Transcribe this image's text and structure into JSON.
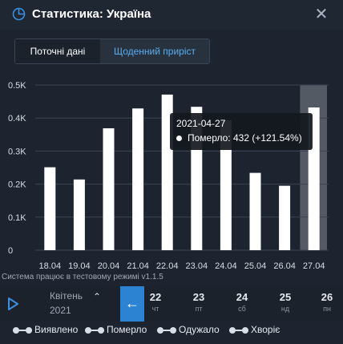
{
  "header": {
    "title": "Статистика: Україна",
    "close_label": "✕"
  },
  "tabs": [
    {
      "label": "Поточні дані",
      "active": false
    },
    {
      "label": "Щоденний приріст",
      "active": true
    }
  ],
  "chart_data": {
    "type": "bar",
    "categories": [
      "18.04",
      "19.04",
      "20.04",
      "21.04",
      "22.04",
      "23.04",
      "24.04",
      "25.04",
      "26.04",
      "27.04"
    ],
    "values": [
      251,
      214,
      369,
      429,
      471,
      434,
      393,
      234,
      195,
      432
    ],
    "ylim": [
      0,
      500
    ],
    "yticks": [
      0,
      100,
      200,
      300,
      400,
      500
    ],
    "ytick_labels": [
      "0",
      "0.1K",
      "0.2K",
      "0.3K",
      "0.4K",
      "0.5K"
    ],
    "highlighted_category": "27.04",
    "grid": true,
    "colors": {
      "bar": "#ffffff",
      "grid": "#3a4453",
      "highlight": "#545a63"
    }
  },
  "tooltip": {
    "date": "2021-04-27",
    "value": "Померло: 432 (+121.54%)"
  },
  "version_text": "Система працює в тестовому режимі v1.1.5",
  "timeline": {
    "month": "Квітень",
    "year": "2021",
    "back_icon": "←",
    "days": [
      {
        "num": "22",
        "wd": "чт"
      },
      {
        "num": "23",
        "wd": "пт"
      },
      {
        "num": "24",
        "wd": "сб"
      },
      {
        "num": "25",
        "wd": "нд"
      },
      {
        "num": "26",
        "wd": "пн"
      }
    ]
  },
  "legend": [
    "Виявлено",
    "Померло",
    "Одужало",
    "Хворіє"
  ],
  "colors": {
    "accent": "#2c83d2",
    "tab_active_text": "#5aaef0",
    "background": "#1d242f"
  }
}
